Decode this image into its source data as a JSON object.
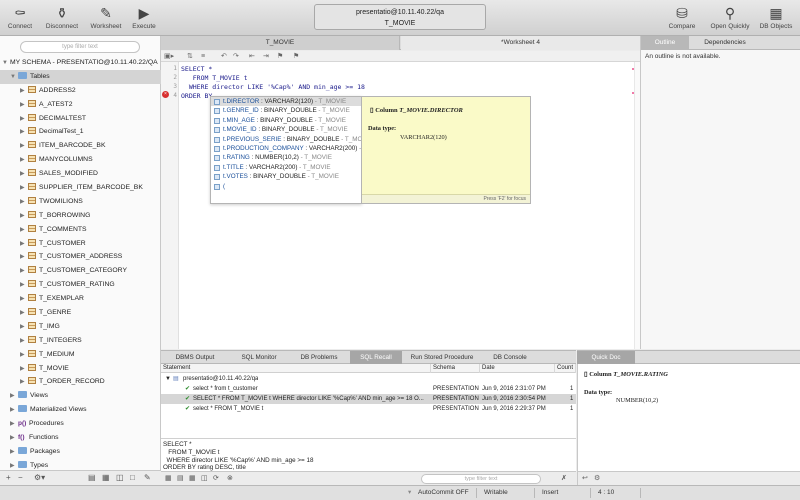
{
  "toolbar": {
    "connect": "Connect",
    "disconnect": "Disconnect",
    "worksheet": "Worksheet",
    "execute": "Execute",
    "compare": "Compare",
    "open_quickly": "Open Quickly",
    "db_objects": "DB Objects",
    "connection_line1": "presentatio@10.11.40.22/qa",
    "connection_line2": "T_MOVIE"
  },
  "left": {
    "filter_placeholder": "type filter text",
    "schema": "MY SCHEMA - PRESENTATIO@10.11.40.22/QA",
    "tables_label": "Tables",
    "tables": [
      "ADDRESS2",
      "A_ATEST2",
      "DECIMALTEST",
      "DecimalTest_1",
      "ITEM_BARCODE_BK",
      "MANYCOLUMNS",
      "SALES_MODIFIED",
      "SUPPLIER_ITEM_BARCODE_BK",
      "TWOMILIONS",
      "T_BORROWING",
      "T_COMMENTS",
      "T_CUSTOMER",
      "T_CUSTOMER_ADDRESS",
      "T_CUSTOMER_CATEGORY",
      "T_CUSTOMER_RATING",
      "T_EXEMPLAR",
      "T_GENRE",
      "T_IMG",
      "T_INTEGERS",
      "T_MEDIUM",
      "T_MOVIE",
      "T_ORDER_RECORD"
    ],
    "others": [
      {
        "label": "Views",
        "kind": "folder"
      },
      {
        "label": "Materialized Views",
        "kind": "folder"
      },
      {
        "label": "Procedures",
        "kind": "proc",
        "prefix": "p()"
      },
      {
        "label": "Functions",
        "kind": "proc",
        "prefix": "f()"
      },
      {
        "label": "Packages",
        "kind": "folder"
      },
      {
        "label": "Types",
        "kind": "folder"
      }
    ]
  },
  "editor": {
    "tab1": "T_MOVIE",
    "tab2": "*Worksheet 4",
    "lines": [
      {
        "n": "1",
        "text": "SELECT *"
      },
      {
        "n": "2",
        "text": "   FROM T_MOVIE t"
      },
      {
        "n": "3",
        "text": "  WHERE director LIKE '%Cap%' AND min_age >= 18"
      },
      {
        "n": "4",
        "text": "ORDER BY "
      }
    ]
  },
  "autocomplete": {
    "items": [
      {
        "name": "t.DIRECTOR",
        "type": " : VARCHAR2(120)",
        "table": " - T_MOVIE"
      },
      {
        "name": "t.GENRE_ID",
        "type": " : BINARY_DOUBLE",
        "table": " - T_MOVIE"
      },
      {
        "name": "t.MIN_AGE",
        "type": " : BINARY_DOUBLE",
        "table": " - T_MOVIE"
      },
      {
        "name": "t.MOVIE_ID",
        "type": " : BINARY_DOUBLE",
        "table": " - T_MOVIE"
      },
      {
        "name": "t.PREVIOUS_SERIE",
        "type": " : BINARY_DOUBLE",
        "table": " - T_MOVIE"
      },
      {
        "name": "t.PRODUCTION_COMPANY",
        "type": " : VARCHAR2(200)",
        "table": " - T_MOVIE"
      },
      {
        "name": "t.RATING",
        "type": " : NUMBER(10,2)",
        "table": " - T_MOVIE"
      },
      {
        "name": "t.TITLE",
        "type": " : VARCHAR2(200)",
        "table": " - T_MOVIE"
      },
      {
        "name": "t.VOTES",
        "type": " : BINARY_DOUBLE",
        "table": " - T_MOVIE"
      },
      {
        "name": "(",
        "type": "",
        "table": ""
      }
    ],
    "doc_prefix": "Column ",
    "doc_name": "T_MOVIE.DIRECTOR",
    "doc_type_label": "Data type:",
    "doc_type_value": "VARCHAR2(120)",
    "doc_footer": "Press 'F2' for focus"
  },
  "right": {
    "tab_outline": "Outline",
    "tab_dependencies": "Dependencies",
    "message": "An outline is not available."
  },
  "bottom": {
    "tabs": [
      "DBMS Output",
      "SQL Monitor",
      "DB Problems",
      "SQL Recall",
      "Run Stored Procedure",
      "DB Console"
    ],
    "active_tab": "SQL Recall",
    "columns": [
      "Statement",
      "Schema",
      "Date",
      "Count"
    ],
    "group": "presentatio@10.11.40.22/qa",
    "rows": [
      {
        "statement": "select * from t_customer",
        "schema": "PRESENTATION",
        "date": "Jun 9, 2016 2:31:07 PM",
        "count": "1"
      },
      {
        "statement": "SELECT * FROM T_MOVIE t WHERE director LIKE '%Cap%' AND min_age >= 18 O...",
        "schema": "PRESENTATION",
        "date": "Jun 9, 2016 2:30:54 PM",
        "count": "1"
      },
      {
        "statement": "select * FROM T_MOVIE t",
        "schema": "PRESENTATION",
        "date": "Jun 9, 2016 2:29:37 PM",
        "count": "1"
      }
    ],
    "statement_text": "SELECT *\n   FROM T_MOVIE t\n  WHERE director LIKE '%Cap%' AND min_age >= 18\nORDER BY rating DESC, title",
    "filter_placeholder": "type filter text"
  },
  "quickdoc": {
    "tab": "Quick Doc",
    "prefix": "Column ",
    "name": "T_MOVIE.RATING",
    "type_label": "Data type:",
    "type_value": "NUMBER(10,2)"
  },
  "status": {
    "autocommit": "AutoCommit OFF",
    "mode": "Writable",
    "insert": "Insert",
    "position": "4 : 10"
  }
}
